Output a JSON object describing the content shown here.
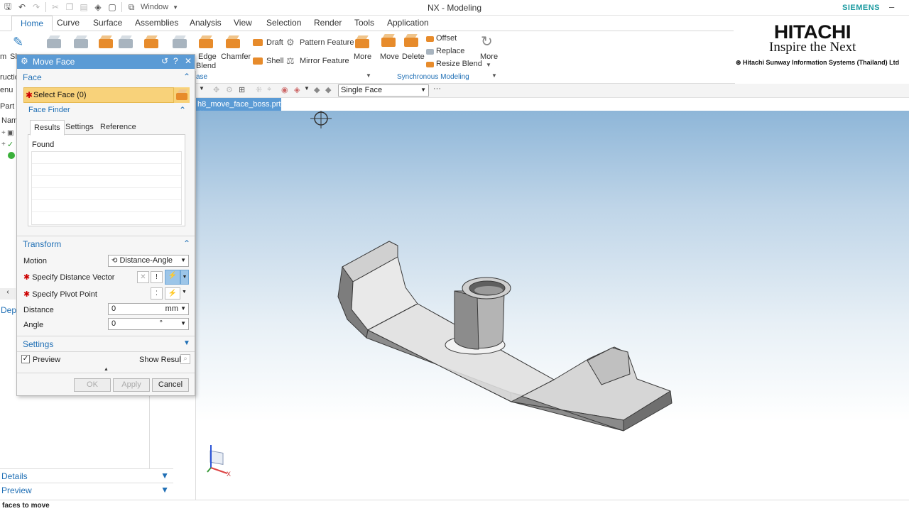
{
  "window": {
    "title": "NX - Modeling",
    "window_menu": "Window",
    "brand": "SIEMENS",
    "minimize": "–"
  },
  "ribbon_tabs": [
    "Home",
    "Curve",
    "Surface",
    "Assemblies",
    "Analysis",
    "View",
    "Selection",
    "Render",
    "Tools",
    "Application"
  ],
  "ribbon": {
    "left_partial": [
      "m",
      "Sk"
    ],
    "features": [
      "Edge",
      "Blend",
      "Chamfer",
      "Draft",
      "Shell",
      "Pattern Feature",
      "Mirror Feature",
      "More"
    ],
    "sync": [
      "Move",
      "Delete",
      "Offset",
      "Replace",
      "Resize Blend",
      "More"
    ],
    "group_base": "ase",
    "group_sync": "Synchronous Modeling"
  },
  "logo": {
    "company": "HITACHI",
    "tagline": "Inspire the Next",
    "subsidiary": "Hitachi Sunway Information Systems (Thailand) Ltd"
  },
  "selection_bar": {
    "filter": "Single Face",
    "more": "···"
  },
  "file_tab": {
    "name": "h8_move_face_boss.prt",
    "close": "×"
  },
  "left_panel": {
    "items": [
      "ructio",
      "enu",
      "Part N",
      "Nam",
      "Dep"
    ],
    "details": "Details",
    "preview": "Preview"
  },
  "dialog": {
    "title": "Move Face",
    "face_section": "Face",
    "select_face": "Select Face (0)",
    "face_finder": "Face Finder",
    "tabs": [
      "Results",
      "Settings",
      "Reference"
    ],
    "found": "Found",
    "transform_section": "Transform",
    "motion_label": "Motion",
    "motion_value": "Distance-Angle",
    "distance_vector": "Specify Distance Vector",
    "pivot_point": "Specify Pivot Point",
    "distance_label": "Distance",
    "distance_value": "0",
    "distance_unit": "mm",
    "angle_label": "Angle",
    "angle_value": "0",
    "angle_unit": "°",
    "settings_section": "Settings",
    "preview_label": "Preview",
    "show_result": "Show Result",
    "ok": "OK",
    "apply": "Apply",
    "cancel": "Cancel"
  },
  "axes": {
    "x": "X"
  },
  "status": "faces to move"
}
